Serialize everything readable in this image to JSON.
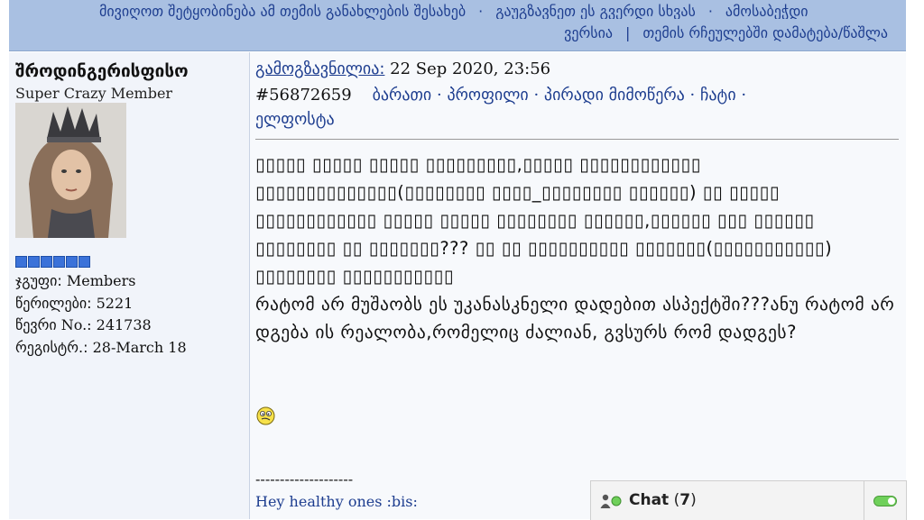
{
  "topbar": {
    "notify_link": "მივიღოთ შეტყობინება ამ თემის განახლების შესახებ",
    "sep1": "·",
    "send_link": "გაუგზავნეთ ეს გვერდი სხვას",
    "sep2": "·",
    "print_link": "ამოსაბეჭდი",
    "print_link_cont": "ვერსია",
    "sep3": "|",
    "favorites_link": "თემის რჩეულებში დამატება/წაშლა"
  },
  "user": {
    "name": "შროდინგერისფისო",
    "title": "Super Crazy Member",
    "rank_pips": 6,
    "group_label": "ჯგუფი:",
    "group_value": "Members",
    "posts_label": "წერილები:",
    "posts_value": "5221",
    "member_no_label": "წევრი",
    "member_no_suffix": "No.:",
    "member_no_value": "241738",
    "registered_label": "რეგისტრ.:",
    "registered_value": "28-March 18"
  },
  "post": {
    "posted_label": "გამოგზავნილია:",
    "posted_date": "22 Sep 2020, 23:56",
    "post_id": "#56872659",
    "links": {
      "card": "ბარათი",
      "profile": "პროფილი",
      "private_msg": "პირადი მიმოწერა",
      "chat": "ჩატი",
      "email": "ელფოსტა",
      "dot": "·"
    },
    "body_unrendered": "▯▯▯▯▯ ▯▯▯▯▯ ▯▯▯▯▯ ▯▯▯▯▯▯▯▯▯,▯▯▯▯▯ ▯▯▯▯▯▯▯▯▯▯▯▯ ▯▯▯▯▯▯▯▯▯▯▯▯▯▯(▯▯▯▯▯▯▯▯ ▯▯▯▯_▯▯▯▯▯▯▯▯ ▯▯▯▯▯▯) ▯▯ ▯▯▯▯▯ ▯▯▯▯▯▯▯▯▯▯▯▯ ▯▯▯▯▯ ▯▯▯▯▯ ▯▯▯▯▯▯▯▯ ▯▯▯▯▯▯,▯▯▯▯▯▯ ▯▯▯ ▯▯▯▯▯▯ ▯▯▯▯▯▯▯▯ ▯▯ ▯▯▯▯▯▯▯??? ▯▯ ▯▯ ▯▯▯▯▯▯▯▯▯▯ ▯▯▯▯▯▯▯(▯▯▯▯▯▯▯▯▯▯▯) ▯▯▯▯▯▯▯▯ ▯▯▯▯▯▯▯▯▯▯▯",
    "body_text": "რატომ არ მუშაობს ეს უკანასკნელი დადებით ასპექტში???ანუ რატომ არ დგება ის რეალობა,რომელიც ძალიან, გვსურს რომ დადგეს?",
    "smiley_icon": "confused-smiley-icon",
    "signature_rule": "--------------------",
    "signature": "Hey healthy ones :bis:"
  },
  "chat_widget": {
    "label": "Chat",
    "count_open": "(",
    "count": "7",
    "count_close": ")",
    "status_color": "#6fd05a"
  }
}
